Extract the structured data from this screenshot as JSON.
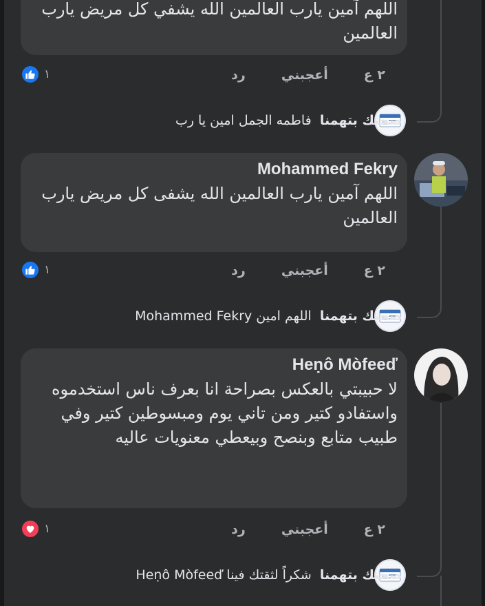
{
  "comments": [
    {
      "author": "",
      "text": "اللهم آمين يارب العالمين الله يشفي كل مريض يارب العالمين",
      "time": "٢ ع",
      "like_label": "أعجبني",
      "reply_label": "رد",
      "reaction_count": "١",
      "reaction_type": "like-icon",
      "reply": {
        "page_name": "صحتك بتهمنا",
        "text": "فاطمه الجمل امين يا رب"
      }
    },
    {
      "author": "Mohammed Fekry",
      "text": "اللهم آمين يارب العالمين الله يشفى كل مريض يارب العالمين",
      "time": "٢ ع",
      "like_label": "أعجبني",
      "reply_label": "رد",
      "reaction_count": "١",
      "reaction_type": "like-icon",
      "reply": {
        "page_name": "صحتك بتهمنا",
        "text": "اللهم امين Mohammed Fekry"
      }
    },
    {
      "author": "Heṇô Mòfeeď",
      "text": "لا حبيبتي بالعكس بصراحة انا بعرف ناس استخدموه واستفادو كتير ومن تاني يوم ومبسوطين كتير  وفي طبيب متابع وبنصح وبيعطي معنويات عاليه",
      "time": "٢ ع",
      "like_label": "أعجبني",
      "reply_label": "رد",
      "reaction_count": "١",
      "reaction_type": "love-icon",
      "reply": {
        "page_name": "صحتك بتهمنا",
        "text": "شكراً لثقتك فينا Heṇô Mòfeeď"
      }
    }
  ],
  "colors": {
    "background": "#2b2c2e",
    "bubble": "#3a3b3c",
    "like_blue": "#1877f2",
    "love_red": "#f33e58"
  }
}
